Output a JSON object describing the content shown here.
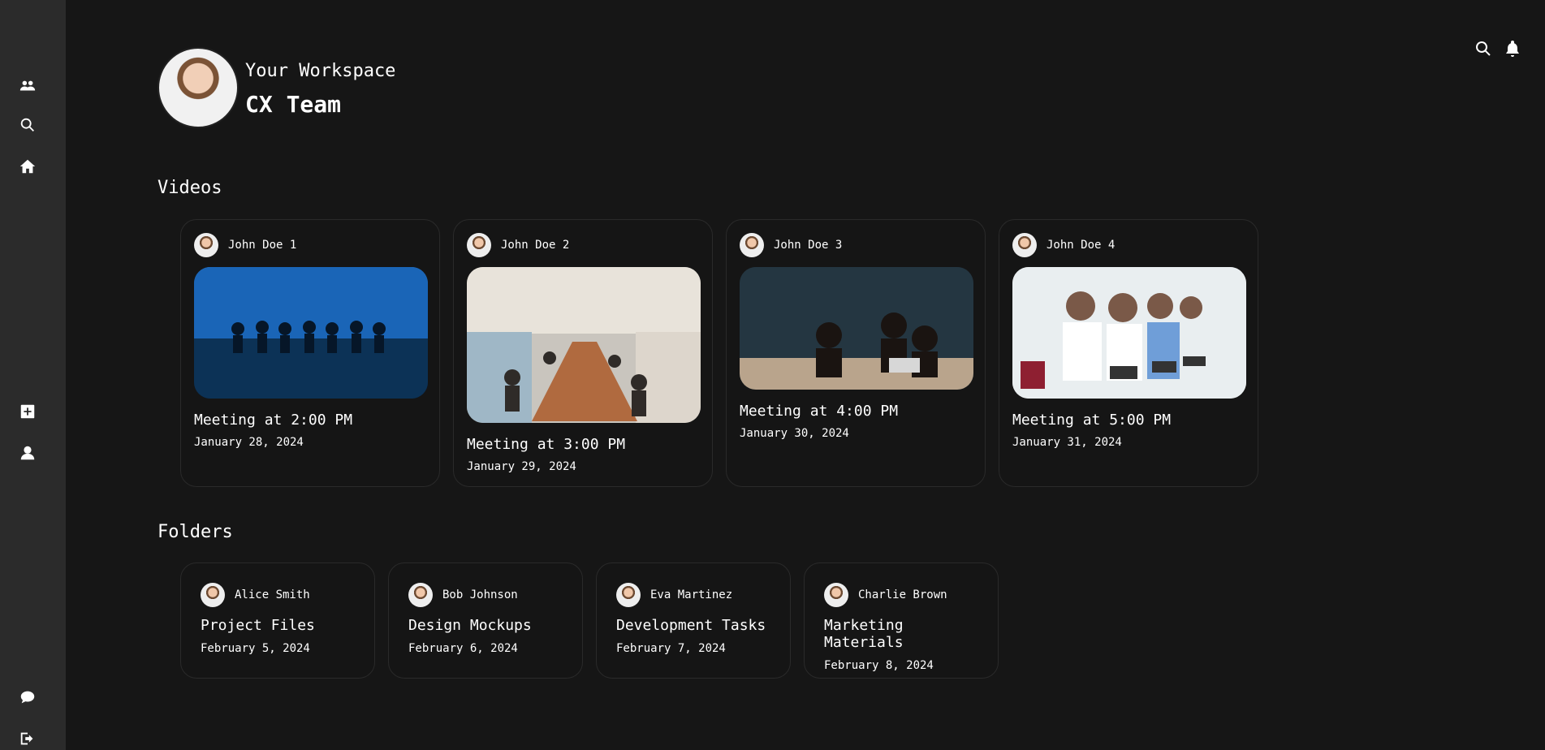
{
  "sidebar": {
    "top_items": [
      {
        "icon": "users-icon"
      },
      {
        "icon": "search-icon"
      },
      {
        "icon": "home-icon"
      }
    ],
    "middle_items": [
      {
        "icon": "add-square-icon"
      },
      {
        "icon": "user-icon"
      }
    ],
    "bottom_items": [
      {
        "icon": "chat-icon"
      },
      {
        "icon": "logout-icon"
      }
    ]
  },
  "header": {
    "workspace_label": "Your Workspace",
    "team_name": "CX Team"
  },
  "topbar": {
    "icons": [
      "search-icon",
      "bell-icon"
    ]
  },
  "sections": {
    "videos_title": "Videos",
    "folders_title": "Folders"
  },
  "videos": [
    {
      "user": "John Doe 1",
      "title": "Meeting at 2:00 PM",
      "date": "January 28, 2024"
    },
    {
      "user": "John Doe 2",
      "title": "Meeting at 3:00 PM",
      "date": "January 29, 2024"
    },
    {
      "user": "John Doe 3",
      "title": "Meeting at 4:00 PM",
      "date": "January 30, 2024"
    },
    {
      "user": "John Doe 4",
      "title": "Meeting at 5:00 PM",
      "date": "January 31, 2024"
    }
  ],
  "folders": [
    {
      "user": "Alice Smith",
      "title": "Project Files",
      "date": "February 5, 2024"
    },
    {
      "user": "Bob Johnson",
      "title": "Design Mockups",
      "date": "February 6, 2024"
    },
    {
      "user": "Eva Martinez",
      "title": "Development Tasks",
      "date": "February 7, 2024"
    },
    {
      "user": "Charlie Brown",
      "title": "Marketing Materials",
      "date": "February 8, 2024"
    }
  ]
}
